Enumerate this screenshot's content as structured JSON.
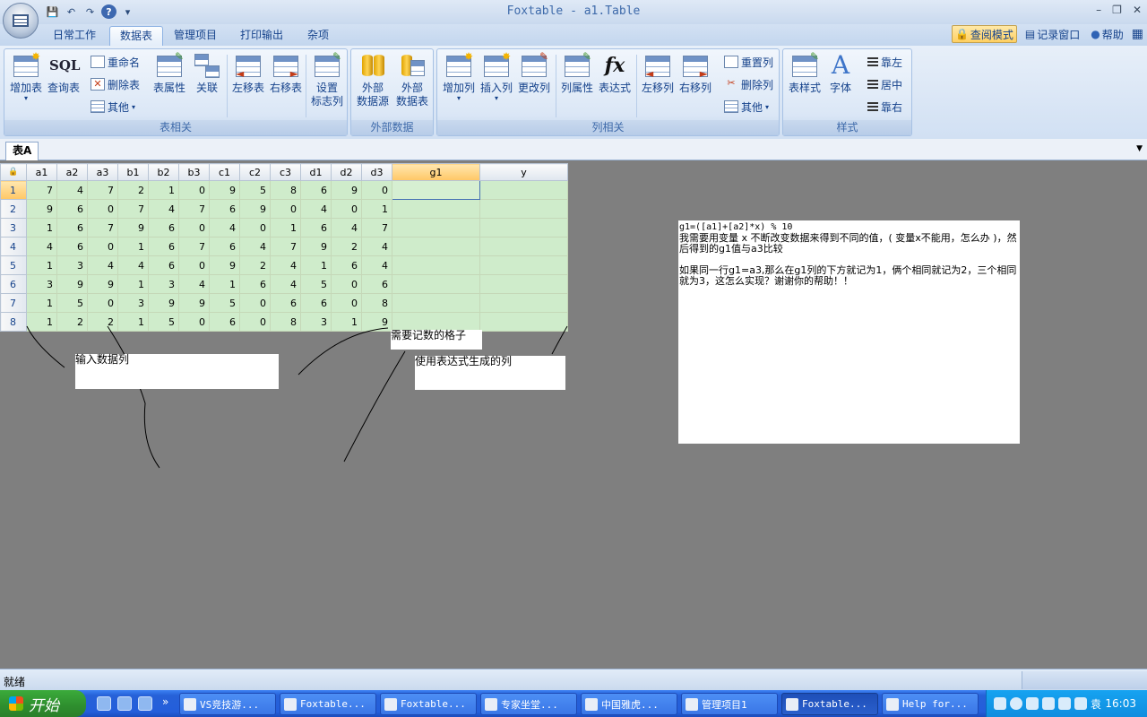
{
  "window": {
    "title": "Foxtable - a1.Table"
  },
  "quick_access": {
    "save": "💾",
    "undo": "↶",
    "redo": "↷",
    "help": "?",
    "more": "▾"
  },
  "ribbon": {
    "tabs": [
      {
        "label": "日常工作",
        "active": false
      },
      {
        "label": "数据表",
        "active": true
      },
      {
        "label": "管理项目",
        "active": false
      },
      {
        "label": "打印输出",
        "active": false
      },
      {
        "label": "杂项",
        "active": false
      }
    ],
    "right_buttons": {
      "readonly_mode": "查阅模式",
      "log_window": "记录窗口",
      "help": "帮助"
    },
    "groups": {
      "table": {
        "label": "表相关",
        "add_table": "增加表",
        "query_table": "查询表",
        "sql_text": "SQL",
        "rename": "重命名",
        "delete_table": "删除表",
        "other": "其他",
        "table_props": "表属性",
        "relation": "关联",
        "move_left": "左移表",
        "move_right": "右移表",
        "set_flag_col_1": "设置",
        "set_flag_col_2": "标志列"
      },
      "external": {
        "label": "外部数据",
        "ext_source_1": "外部",
        "ext_source_2": "数据源",
        "ext_table_1": "外部",
        "ext_table_2": "数据表"
      },
      "column": {
        "label": "列相关",
        "add_col": "增加列",
        "insert_col": "插入列",
        "change_col": "更改列",
        "col_props": "列属性",
        "expression": "表达式",
        "fx_text": "fx",
        "col_left": "左移列",
        "col_right": "右移列",
        "reset_col": "重置列",
        "delete_col": "删除列",
        "other": "其他"
      },
      "style": {
        "label": "样式",
        "table_style": "表样式",
        "font": "字体",
        "font_glyph": "A",
        "align_left": "靠左",
        "align_center": "居中",
        "align_right": "靠右"
      }
    }
  },
  "sheet_tabs": [
    {
      "label": "表A",
      "active": true
    }
  ],
  "grid": {
    "corner": "🔒",
    "columns": [
      "a1",
      "a2",
      "a3",
      "b1",
      "b2",
      "b3",
      "c1",
      "c2",
      "c3",
      "d1",
      "d2",
      "d3",
      "g1",
      "y"
    ],
    "rows": [
      {
        "n": "1",
        "cells": [
          "7",
          "4",
          "7",
          "2",
          "1",
          "0",
          "9",
          "5",
          "8",
          "6",
          "9",
          "0",
          "",
          ""
        ]
      },
      {
        "n": "2",
        "cells": [
          "9",
          "6",
          "0",
          "7",
          "4",
          "7",
          "6",
          "9",
          "0",
          "4",
          "0",
          "1",
          "",
          ""
        ]
      },
      {
        "n": "3",
        "cells": [
          "1",
          "6",
          "7",
          "9",
          "6",
          "0",
          "4",
          "0",
          "1",
          "6",
          "4",
          "7",
          "",
          ""
        ]
      },
      {
        "n": "4",
        "cells": [
          "4",
          "6",
          "0",
          "1",
          "6",
          "7",
          "6",
          "4",
          "7",
          "9",
          "2",
          "4",
          "",
          ""
        ]
      },
      {
        "n": "5",
        "cells": [
          "1",
          "3",
          "4",
          "4",
          "6",
          "0",
          "9",
          "2",
          "4",
          "1",
          "6",
          "4",
          "",
          ""
        ]
      },
      {
        "n": "6",
        "cells": [
          "3",
          "9",
          "9",
          "1",
          "3",
          "4",
          "1",
          "6",
          "4",
          "5",
          "0",
          "6",
          "",
          ""
        ]
      },
      {
        "n": "7",
        "cells": [
          "1",
          "5",
          "0",
          "3",
          "9",
          "9",
          "5",
          "0",
          "6",
          "6",
          "0",
          "8",
          "",
          ""
        ]
      },
      {
        "n": "8",
        "cells": [
          "1",
          "2",
          "2",
          "1",
          "5",
          "0",
          "6",
          "0",
          "8",
          "3",
          "1",
          "9",
          "",
          ""
        ]
      }
    ]
  },
  "annotations": {
    "input_label": "输入数据列",
    "count_label": "需要记数的格子",
    "expr_label": "使用表达式生成的列",
    "question": {
      "formula": "g1=([a1]+[a2]*x) % 10",
      "line1": "我需要用变量 x  不断改变数据来得到不同的值，( 变量x不能用，怎么办 )，然后得到的g1值与a3比较",
      "line2": "如果同一行g1=a3,那么在g1列的下方就记为1，俩个相同就记为2，三个相同就为3，这怎么实现？谢谢你的帮助！！"
    }
  },
  "status": {
    "text": "就绪"
  },
  "taskbar": {
    "start": "开始",
    "more": "»",
    "tasks": [
      {
        "label": "VS竞技游...",
        "active": false
      },
      {
        "label": "Foxtable...",
        "active": false
      },
      {
        "label": "Foxtable...",
        "active": false
      },
      {
        "label": "专家坐堂...",
        "active": false
      },
      {
        "label": "中国雅虎...",
        "active": false
      },
      {
        "label": "管理项目1",
        "active": false
      },
      {
        "label": "Foxtable...",
        "active": true
      },
      {
        "label": "Help for...",
        "active": false
      }
    ],
    "clock": "16:03",
    "ime": "袁"
  }
}
